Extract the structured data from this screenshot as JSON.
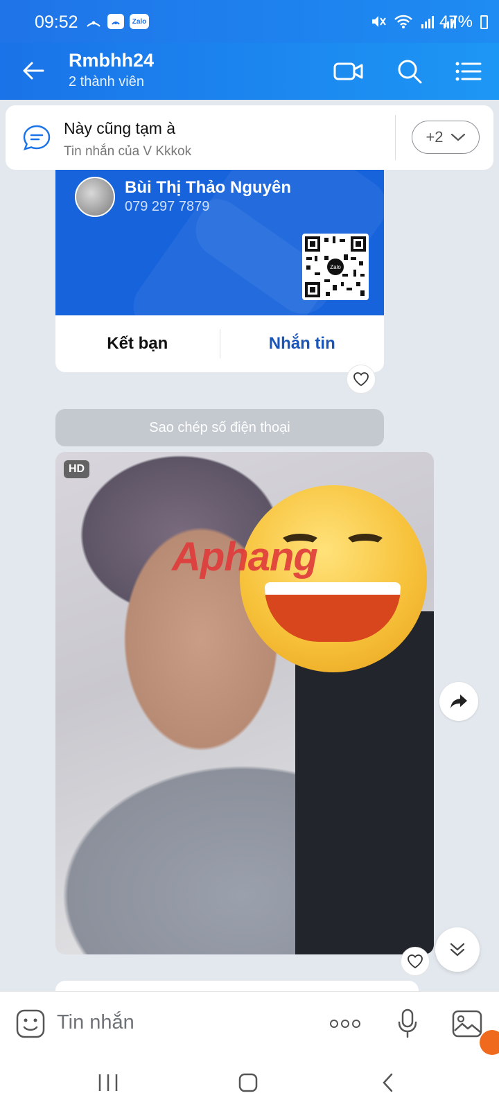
{
  "status_bar": {
    "time": "09:52",
    "battery": "47%",
    "app_badge": "Zalo"
  },
  "header": {
    "title": "Rmbhh24",
    "subtitle": "2 thành viên",
    "accent": "#1a73e8"
  },
  "pinned": {
    "title": "Này cũng tạm à",
    "subtitle": "Tin nhắn của V Kkkok",
    "more_count": "+2"
  },
  "contact_card": {
    "name": "Bùi Thị Thảo Nguyên",
    "phone": "079 297 7879",
    "qr_logo": "Zalo",
    "add_friend": "Kết bạn",
    "message": "Nhắn tin",
    "card_color": "#1763db",
    "message_color": "#1a55b8"
  },
  "copy_phone": "Sao chép số điện thoại",
  "photo": {
    "hd_badge": "HD",
    "watermark": "Aphang"
  },
  "input": {
    "placeholder": "Tin nhắn"
  },
  "icons": {
    "back": "arrow-left-icon",
    "video": "video-call-icon",
    "search": "search-icon",
    "menu": "list-menu-icon",
    "pinned": "chat-bubble-icon",
    "heart": "heart-icon",
    "share": "share-arrow-icon",
    "scroll": "double-chevron-down-icon",
    "emoji": "sticker-face-icon",
    "more": "more-dots-icon",
    "mic": "microphone-icon",
    "image": "image-gallery-icon"
  }
}
